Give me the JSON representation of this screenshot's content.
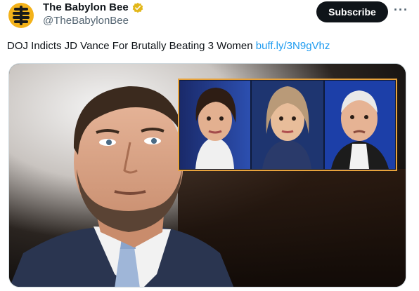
{
  "tweet": {
    "author_name": "The Babylon Bee",
    "author_handle": "@TheBabylonBee",
    "subscribe_label": "Subscribe",
    "text": "DOJ Indicts JD Vance For Brutally Beating 3 Women",
    "link_text": "buff.ly/3N9gVhz"
  },
  "icons": {
    "logo": "babylon-bee-logo-icon",
    "verified": "verified-badge-icon",
    "more": "more-options-icon"
  },
  "colors": {
    "link": "#1d9bf0",
    "verified_gold": "#e2b719",
    "subscribe_bg": "#0f1419",
    "inset_border": "#e8a33c"
  }
}
